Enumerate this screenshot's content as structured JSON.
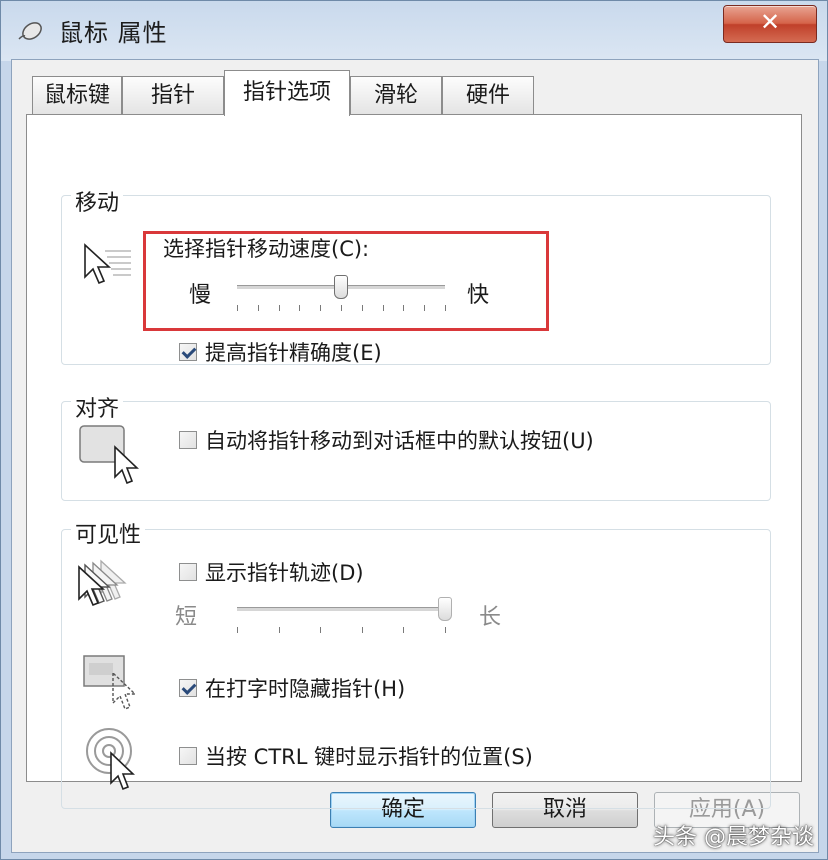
{
  "window": {
    "title": "鼠标 属性",
    "close_glyph": "✕"
  },
  "tabs": [
    {
      "label": "鼠标键"
    },
    {
      "label": "指针"
    },
    {
      "label": "指针选项",
      "active": true
    },
    {
      "label": "滑轮"
    },
    {
      "label": "硬件"
    }
  ],
  "motion": {
    "title": "移动",
    "speed_label": "选择指针移动速度(C):",
    "slow_label": "慢",
    "fast_label": "快",
    "speed_value_fraction": 0.5,
    "precision_label": "提高指针精确度(E)",
    "precision_checked": true
  },
  "snap": {
    "title": "对齐",
    "snap_label": "自动将指针移动到对话框中的默认按钮(U)",
    "snap_checked": false
  },
  "visibility": {
    "title": "可见性",
    "trails_label": "显示指针轨迹(D)",
    "trails_checked": false,
    "short_label": "短",
    "long_label": "长",
    "trails_value_fraction": 1.0,
    "hide_label": "在打字时隐藏指针(H)",
    "hide_checked": true,
    "ctrl_label": "当按 CTRL 键时显示指针的位置(S)",
    "ctrl_checked": false
  },
  "buttons": {
    "ok": "确定",
    "cancel": "取消",
    "apply": "应用(A)"
  },
  "watermark": "头条 @晨梦杂谈",
  "colors": {
    "highlight": "#d9383a",
    "accent": "#3c7fb1"
  },
  "icons": [
    "mouse-icon",
    "close-icon",
    "pointer-speed-icon",
    "snap-to-icon",
    "pointer-trails-icon",
    "hide-pointer-icon",
    "ctrl-locate-icon"
  ]
}
